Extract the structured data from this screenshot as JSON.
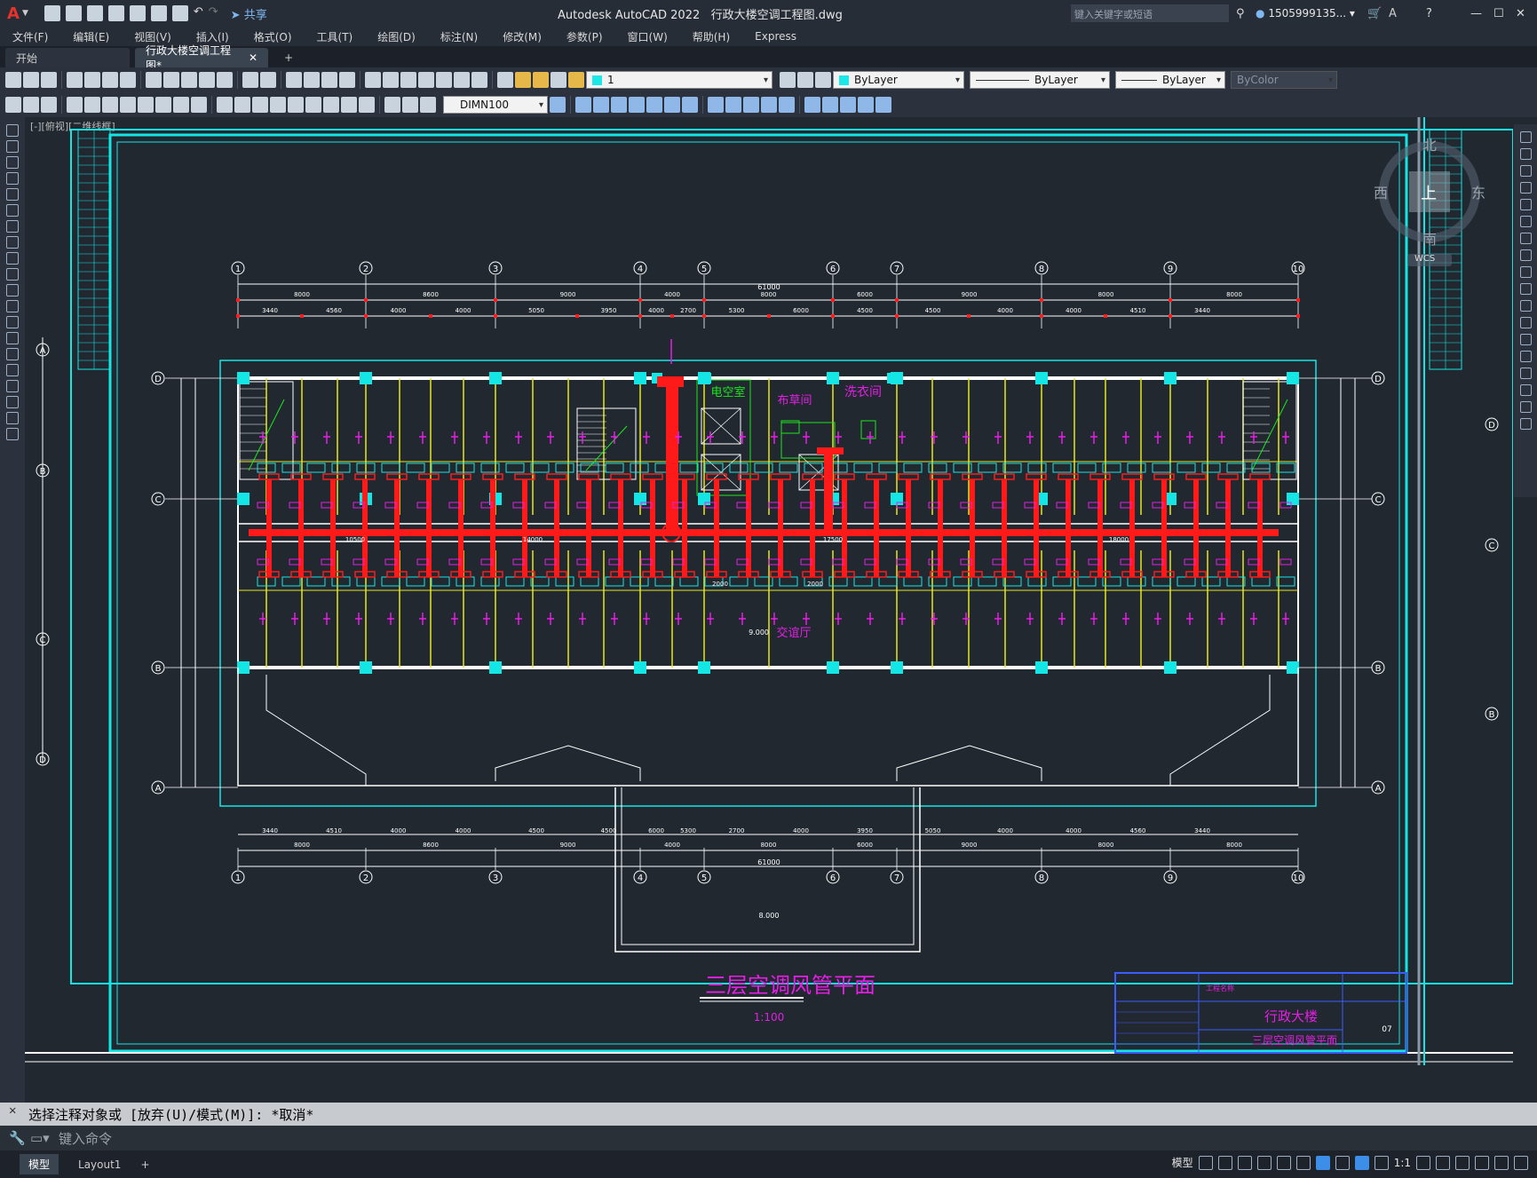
{
  "app": {
    "title": "Autodesk AutoCAD 2022",
    "filename": "行政大楼空调工程图.dwg",
    "share_label": "共享",
    "search_placeholder": "键入关键字或短语",
    "user": "1505999135...",
    "help_label": "?"
  },
  "menu": [
    "文件(F)",
    "编辑(E)",
    "视图(V)",
    "插入(I)",
    "格式(O)",
    "工具(T)",
    "绘图(D)",
    "标注(N)",
    "修改(M)",
    "参数(P)",
    "窗口(W)",
    "帮助(H)",
    "Express"
  ],
  "tabs": {
    "start": "开始",
    "active": "行政大楼空调工程图*",
    "add": "+"
  },
  "properties": {
    "layer": "1",
    "color": "ByLayer",
    "linetype": "ByLayer",
    "lineweight": "ByLayer",
    "plotstyle": "ByColor",
    "dimstyle": "DIMN100"
  },
  "drawing": {
    "title": "三层空调风管平面",
    "scale": "1:100",
    "viewport_label": "[-][俯视][二维线框]",
    "rooms": [
      "电空室",
      "布草间",
      "洗衣间",
      "交谊厅"
    ],
    "elevation": "9.000",
    "elevation2": "8.000",
    "grid_cols": [
      "1",
      "2",
      "3",
      "4",
      "5",
      "6",
      "7",
      "8",
      "9",
      "10"
    ],
    "grid_rows": [
      "D",
      "C",
      "B",
      "A"
    ],
    "total_dim": "61000",
    "top_dims": [
      "8000",
      "8600",
      "9000",
      "4000",
      "8000",
      "6000",
      "9000",
      "8000",
      "8000"
    ],
    "top_sub_dims": [
      "3440",
      "4560",
      "4000",
      "4000",
      "5050",
      "3950",
      "4000",
      "2700",
      "5300",
      "6000",
      "4500",
      "4500",
      "4000",
      "4000",
      "4510",
      "3440"
    ],
    "duct_dims": [
      "10500",
      "14000",
      "17500",
      "18000",
      "2000",
      "2000"
    ],
    "titleblock": {
      "project": "行政大楼",
      "sheet_title": "三层空调风管平面",
      "sheet_no": "07",
      "header": "工程名称"
    },
    "compass": {
      "n": "北",
      "s": "南",
      "e": "东",
      "w": "西",
      "top": "上",
      "wcs": "WCS"
    }
  },
  "command": {
    "history": "选择注释对象或 [放弃(U)/模式(M)]: *取消*",
    "placeholder": "键入命令"
  },
  "status": {
    "model_tab": "模型",
    "layout_tab": "Layout1",
    "model_label": "模型",
    "scale": "1:1"
  }
}
